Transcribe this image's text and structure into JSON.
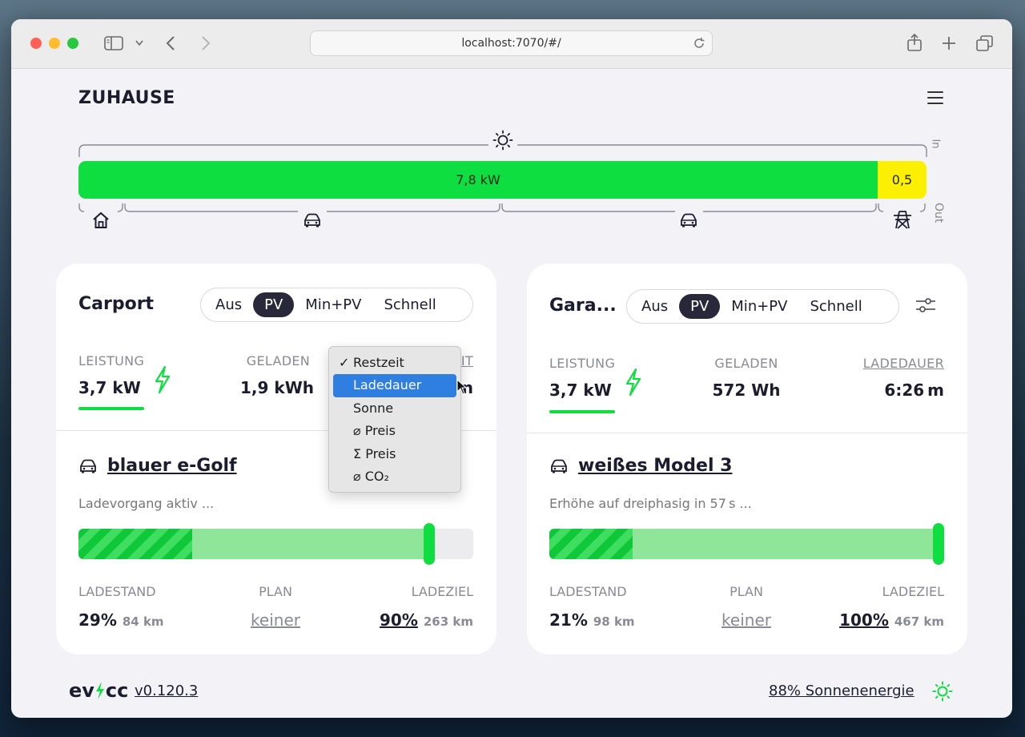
{
  "browser": {
    "url": "localhost:7070/#/"
  },
  "site": {
    "title": "ZUHAUSE"
  },
  "energy": {
    "green_label": "7,8 kW",
    "yellow_label": "0,5",
    "in_label": "In",
    "out_label": "Out",
    "colors": {
      "pv": "#0fde41",
      "grid": "#faf000"
    }
  },
  "loadpoints": [
    {
      "title": "Carport",
      "modes": [
        "Aus",
        "PV",
        "Min+PV",
        "Schnell"
      ],
      "active_mode": "PV",
      "stats": {
        "power_label": "LEISTUNG",
        "power_value": "3,7 kW",
        "charged_label": "GELADEN",
        "charged_value": "1,9 kWh",
        "third_label_fragment": "IT",
        "third_value_fragment": "n"
      },
      "vehicle": "blauer e-Golf",
      "status": "Ladevorgang aktiv ...",
      "soc_percent": 29,
      "limit_percent": 90,
      "bottom": {
        "soc_label": "LADESTAND",
        "soc_value": "29%",
        "soc_range": "84 km",
        "plan_label": "PLAN",
        "plan_value": "keiner",
        "target_label": "LADEZIEL",
        "target_value": "90%",
        "target_range": "263 km"
      }
    },
    {
      "title": "Gara...",
      "modes": [
        "Aus",
        "PV",
        "Min+PV",
        "Schnell"
      ],
      "active_mode": "PV",
      "stats": {
        "power_label": "LEISTUNG",
        "power_value": "3,7 kW",
        "charged_label": "GELADEN",
        "charged_value": "572 Wh",
        "duration_label": "LADEDAUER",
        "duration_value": "6:26 m"
      },
      "vehicle": "weißes Model 3",
      "status": "Erhöhe auf dreiphasig in 57 s ...",
      "soc_percent": 21,
      "limit_percent": 100,
      "bottom": {
        "soc_label": "LADESTAND",
        "soc_value": "21%",
        "soc_range": "98 km",
        "plan_label": "PLAN",
        "plan_value": "keiner",
        "target_label": "LADEZIEL",
        "target_value": "100%",
        "target_range": "467 km"
      }
    }
  ],
  "dropdown": {
    "items": [
      "Restzeit",
      "Ladedauer",
      "Sonne",
      "⌀ Preis",
      "Σ Preis",
      "⌀ CO₂"
    ],
    "checked": "Restzeit",
    "highlighted": "Ladedauer"
  },
  "footer": {
    "logo_left": "ev",
    "logo_right": "cc",
    "version": "v0.120.3",
    "solar_share": "88% Sonnenenergie"
  }
}
